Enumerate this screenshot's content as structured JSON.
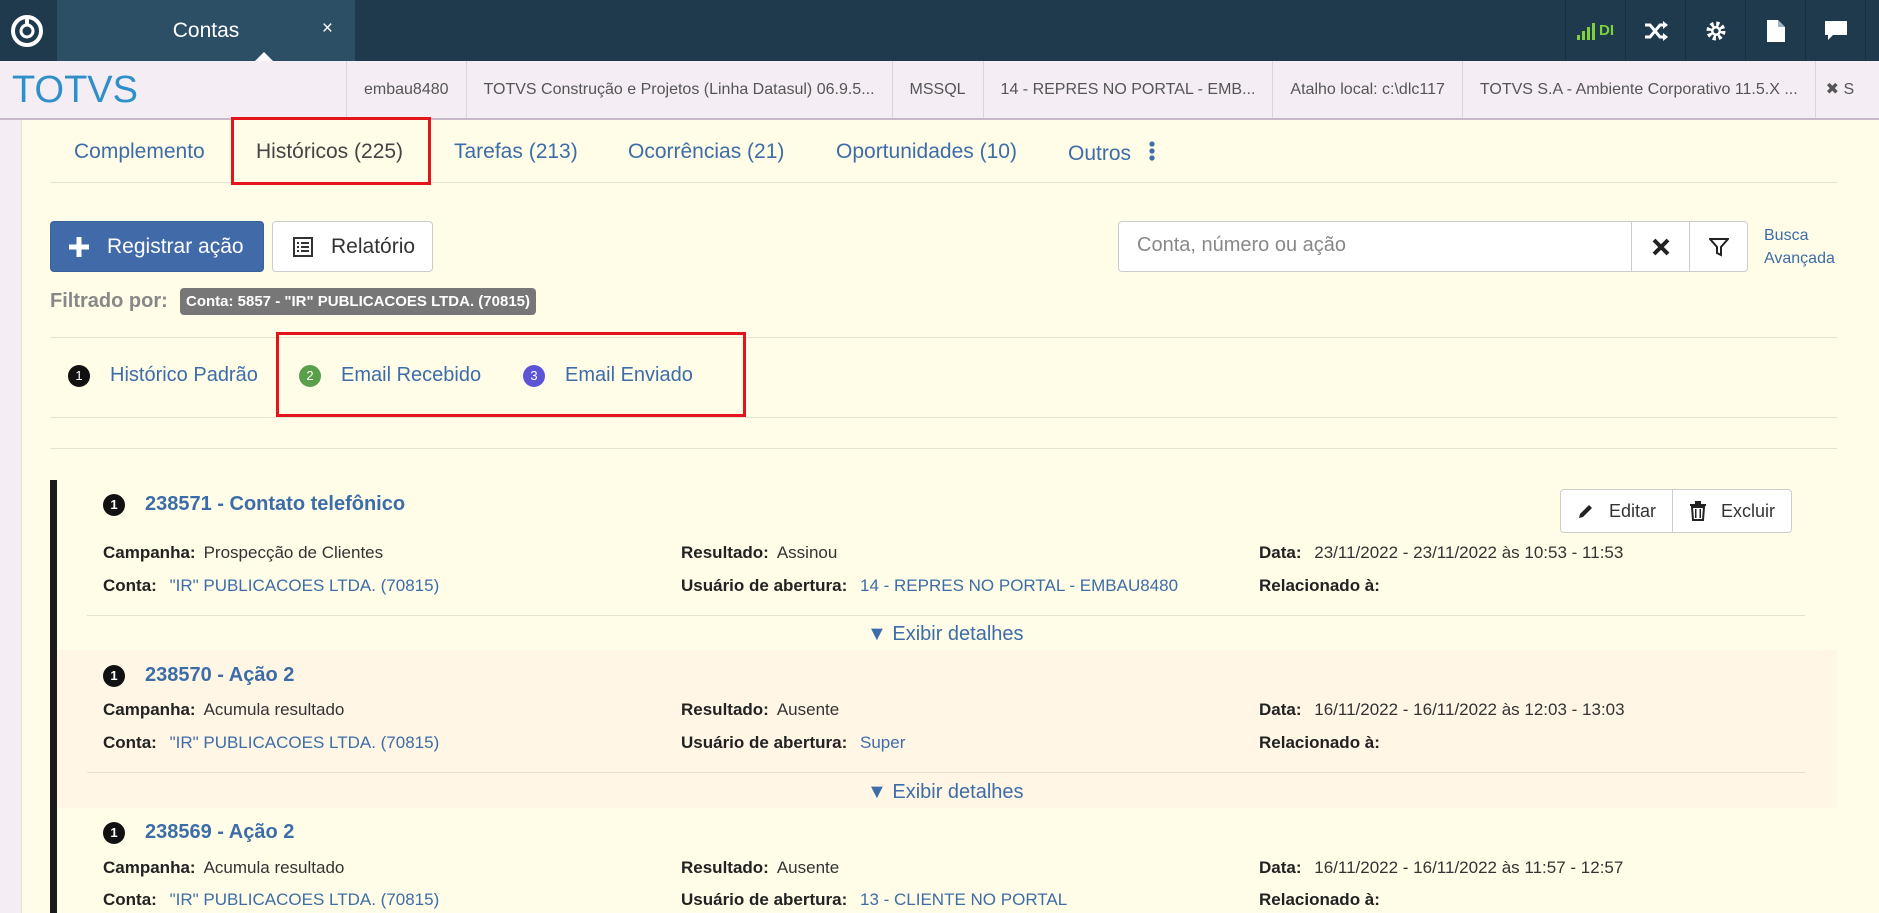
{
  "topbar": {
    "tab_label": "Contas",
    "tab_close": "×",
    "signal_label": "DI",
    "colors": {
      "bg": "#1e3a4c",
      "tab": "#2c4f66"
    }
  },
  "infobar": {
    "brand": "TOTVS",
    "segments": [
      "embau8480",
      "TOTVS Construção e Projetos (Linha Datasul) 06.9.5...",
      "MSSQL",
      "14 - REPRES NO PORTAL - EMB...",
      "Atalho local: c:\\dlc117",
      "TOTVS S.A - Ambiente Corporativo 11.5.X ...",
      "✖ S"
    ]
  },
  "tabs": [
    "Complemento",
    "Históricos (225)",
    "Tarefas (213)",
    "Ocorrências (21)",
    "Oportunidades (10)",
    "Outros"
  ],
  "toolbar": {
    "register_label": "Registrar ação",
    "report_label": "Relatório",
    "search_placeholder": "Conta, número ou ação",
    "advanced_line1": "Busca",
    "advanced_line2": "Avançada"
  },
  "filter": {
    "label": "Filtrado por:",
    "badge": "Conta: 5857 - \"IR\" PUBLICACOES LTDA. (70815)"
  },
  "subtabs": [
    {
      "num": "1",
      "label": "Histórico Padrão",
      "color": "#111111"
    },
    {
      "num": "2",
      "label": "Email Recebido",
      "color": "#5aa04a"
    },
    {
      "num": "3",
      "label": "Email Enviado",
      "color": "#5b55d6"
    }
  ],
  "card_labels": {
    "campanha": "Campanha:",
    "conta": "Conta:",
    "resultado": "Resultado:",
    "usuario": "Usuário de abertura:",
    "data": "Data:",
    "relacionado": "Relacionado à:",
    "details": "▼ Exibir detalhes",
    "edit": "Editar",
    "delete": "Excluir"
  },
  "records": [
    {
      "num": "1",
      "title": "238571 - Contato telefônico",
      "campanha": "Prospecção de Clientes",
      "conta": "\"IR\" PUBLICACOES LTDA. (70815)",
      "resultado": "Assinou",
      "usuario": "14 - REPRES NO PORTAL - EMBAU8480",
      "data": "23/11/2022 - 23/11/2022 às 10:53 - 11:53"
    },
    {
      "num": "1",
      "title": "238570 - Ação 2",
      "campanha": "Acumula resultado",
      "conta": "\"IR\" PUBLICACOES LTDA. (70815)",
      "resultado": "Ausente",
      "usuario": "Super",
      "data": "16/11/2022 - 16/11/2022 às 12:03 - 13:03"
    },
    {
      "num": "1",
      "title": "238569 - Ação 2",
      "campanha": "Acumula resultado",
      "conta": "\"IR\" PUBLICACOES LTDA. (70815)",
      "resultado": "Ausente",
      "usuario": "13 - CLIENTE NO PORTAL",
      "data": "16/11/2022 - 16/11/2022 às 11:57 - 12:57"
    }
  ]
}
